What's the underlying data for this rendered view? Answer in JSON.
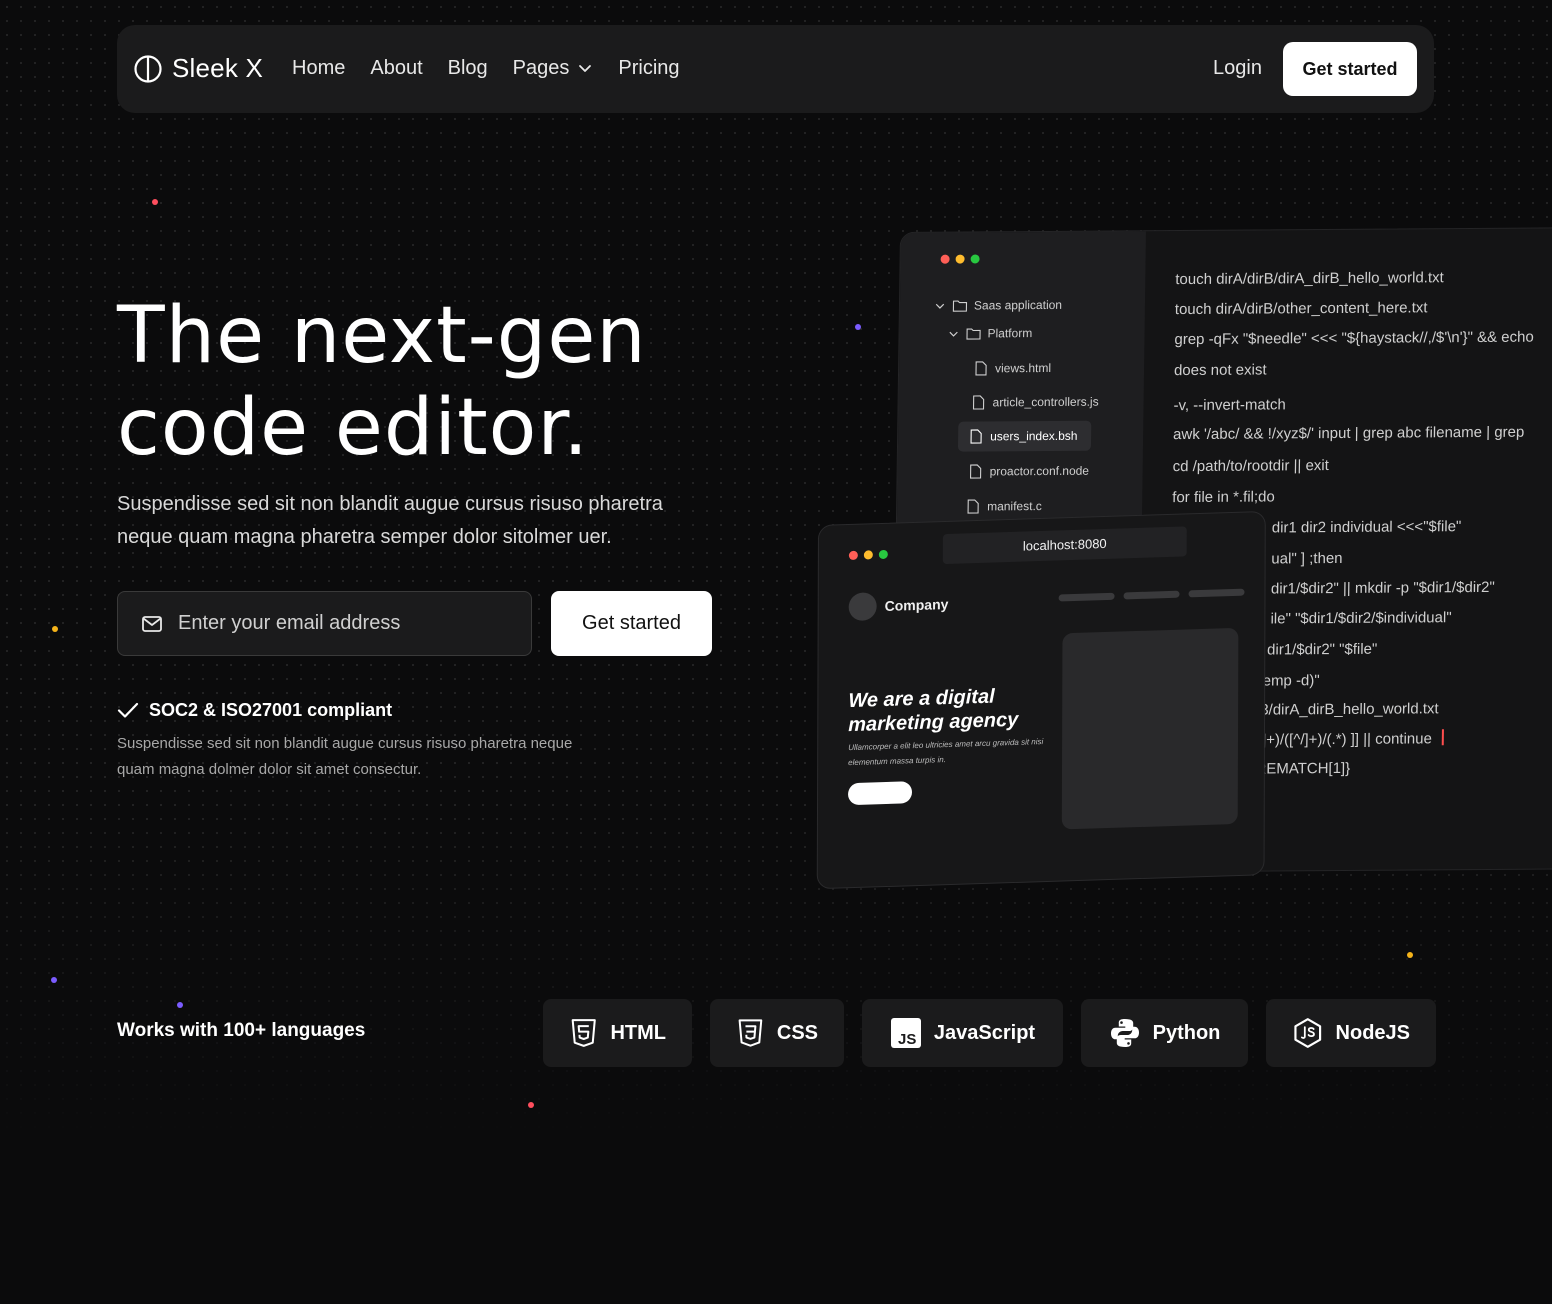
{
  "nav": {
    "brand": "Sleek X",
    "items": [
      "Home",
      "About",
      "Blog",
      "Pages",
      "Pricing"
    ],
    "login": "Login",
    "cta": "Get started"
  },
  "hero": {
    "headline": "The next-gen\ncode editor.",
    "subtitle": "Suspendisse sed sit non blandit augue cursus risuso pharetra neque quam magna pharetra semper dolor sitolmer uer.",
    "email_placeholder": "Enter your email address",
    "cta": "Get started",
    "compliance_title": "SOC2 & ISO27001 compliant",
    "compliance_text": "Suspendisse sed sit non blandit augue cursus risuso pharetra neque quam magna dolmer dolor sit amet consectur."
  },
  "editor": {
    "tree": [
      "Saas application",
      "Platform",
      "views.html",
      "article_controllers.js",
      "users_index.bsh",
      "proactor.conf.node",
      "manifest.c"
    ],
    "code": [
      "touch dirA/dirB/dirA_dirB_hello_world.txt",
      "touch dirA/dirB/other_content_here.txt",
      "grep -qFx \"$needle\" <<< \"${haystack//,/$'\\n'}\" && echo",
      "does not exist",
      "-v, --invert-match",
      "awk '/abc/ && !/xyz$/' input | grep abc filename | grep",
      "cd /path/to/rootdir || exit",
      "for file in *.fil;do",
      "dir1 dir2 individual <<<\"$file\"",
      "ual\" ] ;then",
      "dir1/$dir2\" || mkdir -p \"$dir1/$dir2\"",
      "ile\" \"$dir1/$dir2/$individual\"",
      "dir1/$dir2\" \"$file\"",
      "emp -d)\"",
      "3/dirA_dirB_hello_world.txt",
      "/]+)/([^/]+)/(.*) ]] || continue",
      "REMATCH[1]}"
    ]
  },
  "browser": {
    "url": "localhost:8080",
    "company": "Company",
    "title": "We are a digital\nmarketing agency",
    "text": "Ullamcorper a elit leo ultricies amet arcu gravida sit nisi elementum massa turpis in."
  },
  "languages": {
    "label": "Works with 100+ languages",
    "items": [
      "HTML",
      "CSS",
      "JavaScript",
      "Python",
      "NodeJS"
    ]
  },
  "colors": {
    "background": "#0b0b0c",
    "card": "#1b1b1c",
    "dot_red": "#ff5f57",
    "dot_yellow": "#febc2e",
    "dot_green": "#28c840",
    "spark_red": "#ff4e5e",
    "spark_purple": "#7b5cff",
    "spark_yellow": "#f5b31a"
  }
}
